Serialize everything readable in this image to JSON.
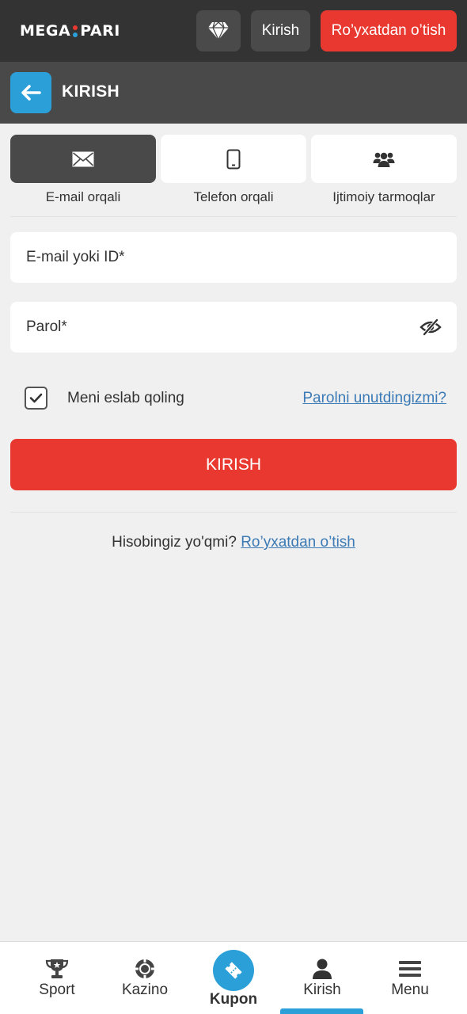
{
  "header": {
    "logo_left": "MEGA",
    "logo_right": "PARI",
    "login_label": "Kirish",
    "register_label": "Ro’yxatdan o’tish",
    "gem_icon": "diamond-icon"
  },
  "titlebar": {
    "back_icon": "arrow-left-icon",
    "title": "KIRISH"
  },
  "methods": [
    {
      "label": "E-mail orqali",
      "icon": "envelope-icon",
      "active": true
    },
    {
      "label": "Telefon orqali",
      "icon": "phone-icon",
      "active": false
    },
    {
      "label": "Ijtimoiy tarmoqlar",
      "icon": "users-icon",
      "active": false
    }
  ],
  "form": {
    "email_placeholder": "E-mail yoki ID*",
    "password_placeholder": "Parol*",
    "remember_label": "Meni eslab qoling",
    "remember_checked": true,
    "forgot_label": "Parolni unutdingizmi?",
    "submit_label": "KIRISH",
    "no_account_text": "Hisobingiz yo'qmi?",
    "register_link": "Ro’yxatdan o’tish"
  },
  "bottom_nav": [
    {
      "label": "Sport",
      "icon": "trophy-icon"
    },
    {
      "label": "Kazino",
      "icon": "casino-chip-icon"
    },
    {
      "label": "Kupon",
      "icon": "ticket-icon"
    },
    {
      "label": "Kirish",
      "icon": "user-icon",
      "active": true
    },
    {
      "label": "Menu",
      "icon": "hamburger-icon"
    }
  ],
  "colors": {
    "header_bg": "#333333",
    "titlebar_bg": "#494949",
    "accent_red": "#e8382f",
    "accent_blue": "#2b9fd8",
    "link": "#3b7ab5",
    "page_bg": "#f0f0f0"
  }
}
